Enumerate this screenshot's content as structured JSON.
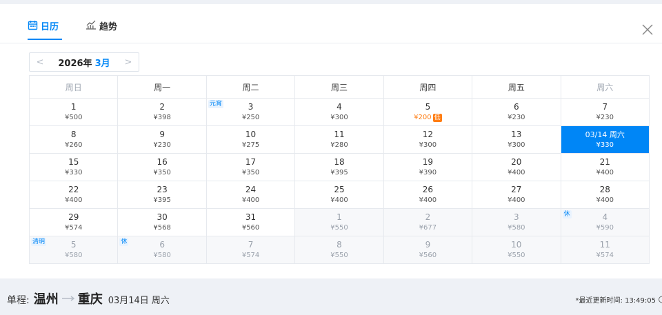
{
  "tabs": {
    "calendar": "日历",
    "trend": "趋势"
  },
  "month_nav": {
    "prev": "<",
    "year": "2026年",
    "month": "3月",
    "next": ">"
  },
  "weekdays": [
    "周日",
    "周一",
    "周二",
    "周三",
    "周四",
    "周五",
    "周六"
  ],
  "weeks": [
    [
      {
        "day": "1",
        "price": "¥500"
      },
      {
        "day": "2",
        "price": "¥398"
      },
      {
        "day": "3",
        "price": "¥250",
        "tag": "元宵"
      },
      {
        "day": "4",
        "price": "¥300"
      },
      {
        "day": "5",
        "price": "¥200",
        "low": "低"
      },
      {
        "day": "6",
        "price": "¥230"
      },
      {
        "day": "7",
        "price": "¥230"
      }
    ],
    [
      {
        "day": "8",
        "price": "¥260"
      },
      {
        "day": "9",
        "price": "¥230"
      },
      {
        "day": "10",
        "price": "¥275"
      },
      {
        "day": "11",
        "price": "¥280"
      },
      {
        "day": "12",
        "price": "¥300"
      },
      {
        "day": "13",
        "price": "¥300"
      },
      {
        "day": "03/14 周六",
        "price": "¥330",
        "selected": true
      }
    ],
    [
      {
        "day": "15",
        "price": "¥330"
      },
      {
        "day": "16",
        "price": "¥350"
      },
      {
        "day": "17",
        "price": "¥350"
      },
      {
        "day": "18",
        "price": "¥395"
      },
      {
        "day": "19",
        "price": "¥390"
      },
      {
        "day": "20",
        "price": "¥400"
      },
      {
        "day": "21",
        "price": "¥400"
      }
    ],
    [
      {
        "day": "22",
        "price": "¥400"
      },
      {
        "day": "23",
        "price": "¥395"
      },
      {
        "day": "24",
        "price": "¥400"
      },
      {
        "day": "25",
        "price": "¥400"
      },
      {
        "day": "26",
        "price": "¥400"
      },
      {
        "day": "27",
        "price": "¥400"
      },
      {
        "day": "28",
        "price": "¥400"
      }
    ],
    [
      {
        "day": "29",
        "price": "¥574"
      },
      {
        "day": "30",
        "price": "¥568"
      },
      {
        "day": "31",
        "price": "¥560"
      },
      {
        "day": "1",
        "price": "¥550",
        "other": true
      },
      {
        "day": "2",
        "price": "¥677",
        "other": true
      },
      {
        "day": "3",
        "price": "¥580",
        "other": true
      },
      {
        "day": "4",
        "price": "¥590",
        "other": true,
        "tag": "休"
      }
    ],
    [
      {
        "day": "5",
        "price": "¥580",
        "other": true,
        "tag": "清明"
      },
      {
        "day": "6",
        "price": "¥580",
        "other": true,
        "tag": "休"
      },
      {
        "day": "7",
        "price": "¥574",
        "other": true
      },
      {
        "day": "8",
        "price": "¥550",
        "other": true
      },
      {
        "day": "9",
        "price": "¥560",
        "other": true
      },
      {
        "day": "10",
        "price": "¥550",
        "other": true
      },
      {
        "day": "11",
        "price": "¥574",
        "other": true
      }
    ]
  ],
  "footer": {
    "trip_type": "单程:",
    "from_city": "温州",
    "to_city": "重庆",
    "date": "03月14日 周六",
    "update_time": "*最近更新时间: 13:49:05"
  },
  "colors": {
    "accent": "#0086f6",
    "low_price": "#ff7d13"
  }
}
